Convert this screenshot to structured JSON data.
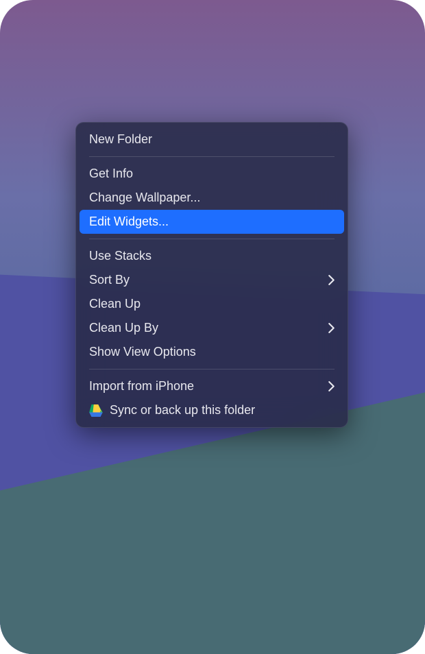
{
  "menu": {
    "items": [
      {
        "label": "New Folder",
        "hasSubmenu": false,
        "icon": null,
        "highlighted": false
      },
      {
        "separator": true
      },
      {
        "label": "Get Info",
        "hasSubmenu": false,
        "icon": null,
        "highlighted": false
      },
      {
        "label": "Change Wallpaper...",
        "hasSubmenu": false,
        "icon": null,
        "highlighted": false
      },
      {
        "label": "Edit Widgets...",
        "hasSubmenu": false,
        "icon": null,
        "highlighted": true
      },
      {
        "separator": true
      },
      {
        "label": "Use Stacks",
        "hasSubmenu": false,
        "icon": null,
        "highlighted": false
      },
      {
        "label": "Sort By",
        "hasSubmenu": true,
        "icon": null,
        "highlighted": false
      },
      {
        "label": "Clean Up",
        "hasSubmenu": false,
        "icon": null,
        "highlighted": false
      },
      {
        "label": "Clean Up By",
        "hasSubmenu": true,
        "icon": null,
        "highlighted": false
      },
      {
        "label": "Show View Options",
        "hasSubmenu": false,
        "icon": null,
        "highlighted": false
      },
      {
        "separator": true
      },
      {
        "label": "Import from iPhone",
        "hasSubmenu": true,
        "icon": null,
        "highlighted": false
      },
      {
        "label": "Sync or back up this folder",
        "hasSubmenu": false,
        "icon": "drive",
        "highlighted": false
      }
    ]
  }
}
